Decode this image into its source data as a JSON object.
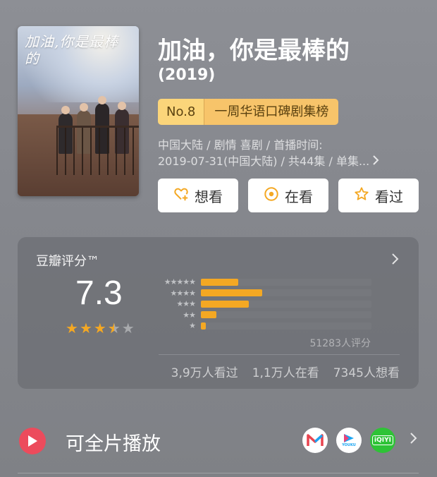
{
  "poster": {
    "title": "加油,你是最棒的"
  },
  "header": {
    "title": "加油，你是最棒的",
    "year": "(2019)",
    "rank_no": "No.8",
    "rank_name": "一周华语口碑剧集榜",
    "meta_line1": "中国大陆 / 剧情 喜剧 / 首播时间:",
    "meta_line2": "2019-07-31(中国大陆) / 共44集 / 单集...",
    "meta_more_icon": "chevron-right-icon"
  },
  "actions": [
    {
      "label": "想看",
      "icon": "heart-plus-icon"
    },
    {
      "label": "在看",
      "icon": "target-circle-icon"
    },
    {
      "label": "看过",
      "icon": "star-outline-icon"
    }
  ],
  "rating": {
    "label": "豆瓣评分™",
    "score": "7.3",
    "stars": 3.5,
    "distribution": [
      {
        "stars": "★★★★★",
        "fraction": 0.22
      },
      {
        "stars": "★★★★",
        "fraction": 0.36
      },
      {
        "stars": "★★★",
        "fraction": 0.28
      },
      {
        "stars": "★★",
        "fraction": 0.09
      },
      {
        "stars": "★",
        "fraction": 0.03
      }
    ],
    "votes": "51283人评分",
    "watched": "3,9万人看过",
    "watching": "1,1万人在看",
    "want": "7345人想看"
  },
  "play": {
    "label": "可全片播放",
    "platforms": [
      {
        "name": "mango-tv-icon",
        "color": "#e8434f"
      },
      {
        "name": "youku-icon",
        "color": "#1aa5f3",
        "text": "YOUKU"
      },
      {
        "name": "iqiyi-icon",
        "color": "#2ec336",
        "text": "iQIYI"
      }
    ]
  },
  "colors": {
    "accent": "#f4a823",
    "rank_bg": "#f7c46a",
    "play_red": "#ec4b5c"
  }
}
